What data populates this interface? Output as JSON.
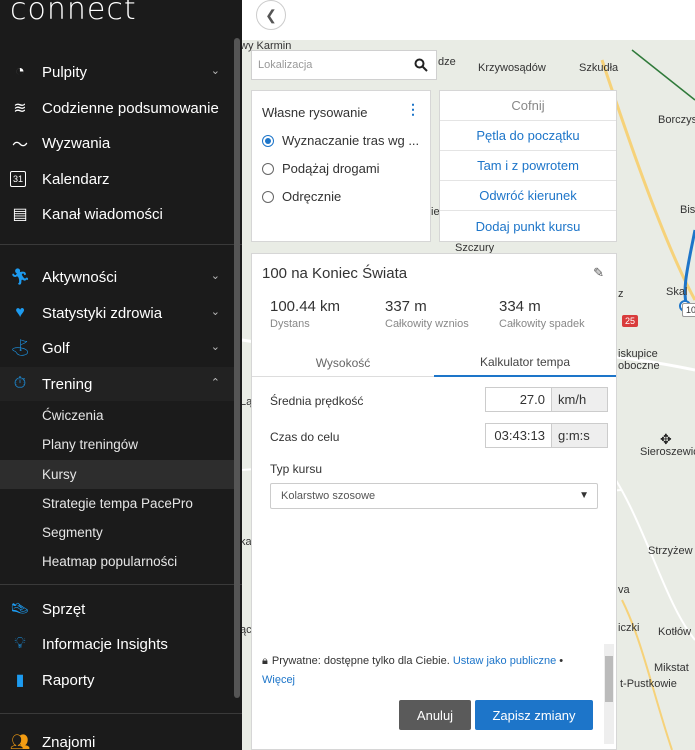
{
  "sidebar": {
    "logo": "connect",
    "items": [
      {
        "label": "Pulpity",
        "icon": "dashboard-icon",
        "chevron": "down"
      },
      {
        "label": "Codzienne podsumowanie",
        "icon": "layers-icon"
      },
      {
        "label": "Wyzwania",
        "icon": "trend-icon"
      },
      {
        "label": "Kalendarz",
        "icon": "calendar-icon",
        "calendar_day": "31"
      },
      {
        "label": "Kanał wiadomości",
        "icon": "news-icon"
      },
      {
        "label": "Aktywności",
        "icon": "runner-icon",
        "chevron": "down"
      },
      {
        "label": "Statystyki zdrowia",
        "icon": "heart-icon",
        "chevron": "down"
      },
      {
        "label": "Golf",
        "icon": "golfer-icon",
        "chevron": "down"
      },
      {
        "label": "Trening",
        "icon": "stopwatch-icon",
        "chevron": "up"
      },
      {
        "label": "Sprzęt",
        "icon": "shoe-icon"
      },
      {
        "label": "Informacje Insights",
        "icon": "lightbulb-icon"
      },
      {
        "label": "Raporty",
        "icon": "bar-chart-icon"
      },
      {
        "label": "Znajomi",
        "icon": "friends-icon"
      }
    ],
    "subitems": [
      {
        "label": "Ćwiczenia"
      },
      {
        "label": "Plany treningów"
      },
      {
        "label": "Kursy",
        "active": true
      },
      {
        "label": "Strategie tempa PacePro"
      },
      {
        "label": "Segmenty"
      },
      {
        "label": "Heatmap popularności"
      }
    ]
  },
  "search": {
    "placeholder": "Lokalizacja"
  },
  "drawing": {
    "title": "Własne rysowanie",
    "options": [
      {
        "label": "Wyznaczanie tras wg ...",
        "selected": true
      },
      {
        "label": "Podążaj drogami",
        "selected": false
      },
      {
        "label": "Odręcznie",
        "selected": false
      }
    ]
  },
  "actions": {
    "undo": "Cofnij",
    "loop": "Pętla do początku",
    "out_back": "Tam i z powrotem",
    "reverse": "Odwróć kierunek",
    "add_point": "Dodaj punkt kursu"
  },
  "course": {
    "title": "100 na Koniec Świata",
    "distance_value": "100.44 km",
    "distance_label": "Dystans",
    "ascent_value": "337 m",
    "ascent_label": "Całkowity wznios",
    "descent_value": "334 m",
    "descent_label": "Całkowity spadek",
    "tab_elevation": "Wysokość",
    "tab_pace": "Kalkulator tempa",
    "avg_speed_label": "Średnia prędkość",
    "avg_speed_value": "27.0",
    "avg_speed_unit": "km/h",
    "time_label": "Czas do celu",
    "time_value": "03:43:13",
    "time_unit": "g:m:s",
    "type_label": "Typ kursu",
    "type_value": "Kolarstwo szosowe",
    "privacy_text": "Prywatne: dostępne tylko dla Ciebie.",
    "privacy_link": "Ustaw jako publiczne",
    "privacy_sep": "•",
    "more_link": "Więcej",
    "cancel": "Anuluj",
    "save": "Zapisz zmiany"
  },
  "map": {
    "labels": {
      "karmin": "wy Karmin",
      "dze": "dze",
      "krzywosadow": "Krzywosądów",
      "szkudla": "Szkudła",
      "borczys": "Borczys",
      "bis": "Bis",
      "szczury": "Szczury",
      "skal": "Skal",
      "route_badge": "10",
      "road_25": "25",
      "z": "z",
      "iskupice": "iskupice",
      "oboczne": "oboczne",
      "la": "Lą",
      "sieroszewice": "Sieroszewice",
      "strzyzew": "Strzyżew",
      "va": "va",
      "iczki": "iczki",
      "kotlow": "Kotłów",
      "mikstat": "Mikstat",
      "pustkowie": "t-Pustkowie",
      "ie": "ie",
      "ka": "ka",
      "ac": "ąc",
      "i": "i"
    }
  }
}
